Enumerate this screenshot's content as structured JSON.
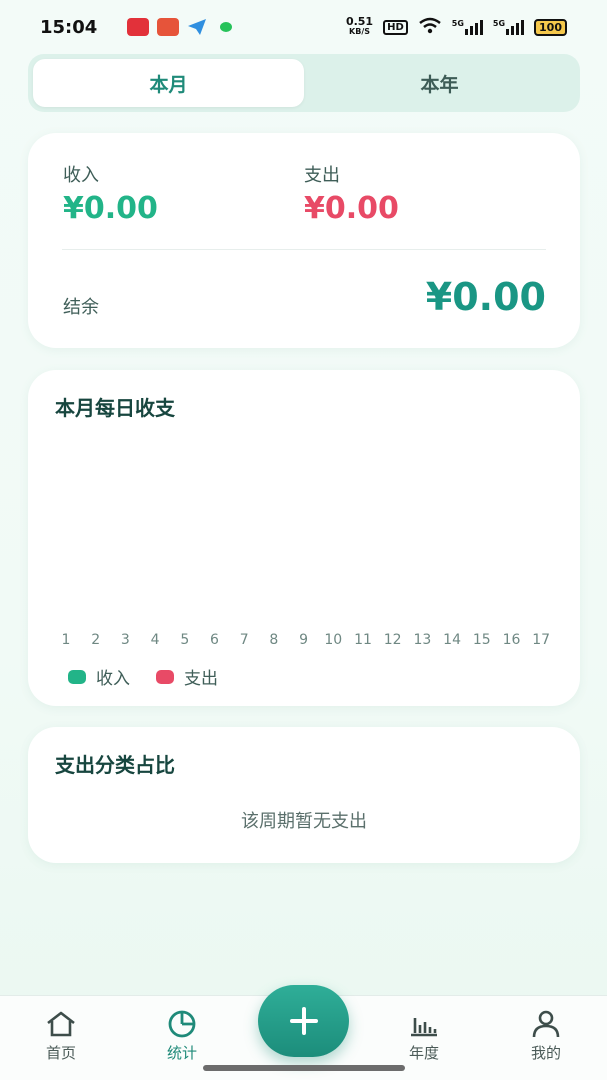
{
  "status_bar": {
    "time": "15:04",
    "speed_value": "0.51",
    "speed_unit": "KB/S",
    "hd": "HD",
    "net1": "5G",
    "net2": "5G",
    "battery": "100"
  },
  "tabs": [
    {
      "label": "本月",
      "active": true
    },
    {
      "label": "本年",
      "active": false
    }
  ],
  "summary": {
    "income_label": "收入",
    "income_value": "¥0.00",
    "expense_label": "支出",
    "expense_value": "¥0.00",
    "balance_label": "结余",
    "balance_value": "¥0.00"
  },
  "daily_chart": {
    "title": "本月每日收支",
    "legend": [
      {
        "label": "收入",
        "color": "#22b488"
      },
      {
        "label": "支出",
        "color": "#e84a66"
      }
    ]
  },
  "chart_data": {
    "type": "bar",
    "title": "本月每日收支",
    "categories": [
      "1",
      "2",
      "3",
      "4",
      "5",
      "6",
      "7",
      "8",
      "9",
      "10",
      "11",
      "12",
      "13",
      "14",
      "15",
      "16",
      "17"
    ],
    "series": [
      {
        "name": "收入",
        "values": [
          0,
          0,
          0,
          0,
          0,
          0,
          0,
          0,
          0,
          0,
          0,
          0,
          0,
          0,
          0,
          0,
          0
        ]
      },
      {
        "name": "支出",
        "values": [
          0,
          0,
          0,
          0,
          0,
          0,
          0,
          0,
          0,
          0,
          0,
          0,
          0,
          0,
          0,
          0,
          0
        ]
      }
    ],
    "legend_position": "bottom-left",
    "grid": false
  },
  "category_card": {
    "title": "支出分类占比",
    "empty_text": "该周期暂无支出"
  },
  "nav": {
    "items": [
      {
        "label": "首页",
        "icon": "home-icon",
        "active": false
      },
      {
        "label": "统计",
        "icon": "pie-chart-icon",
        "active": true
      },
      {
        "label": "年度",
        "icon": "bar-chart-icon",
        "active": false
      },
      {
        "label": "我的",
        "icon": "person-icon",
        "active": false
      }
    ],
    "add_icon": "plus-icon"
  },
  "colors": {
    "accent": "#1f8a79",
    "income": "#22b488",
    "expense": "#e84a66",
    "balance": "#1a9684"
  }
}
